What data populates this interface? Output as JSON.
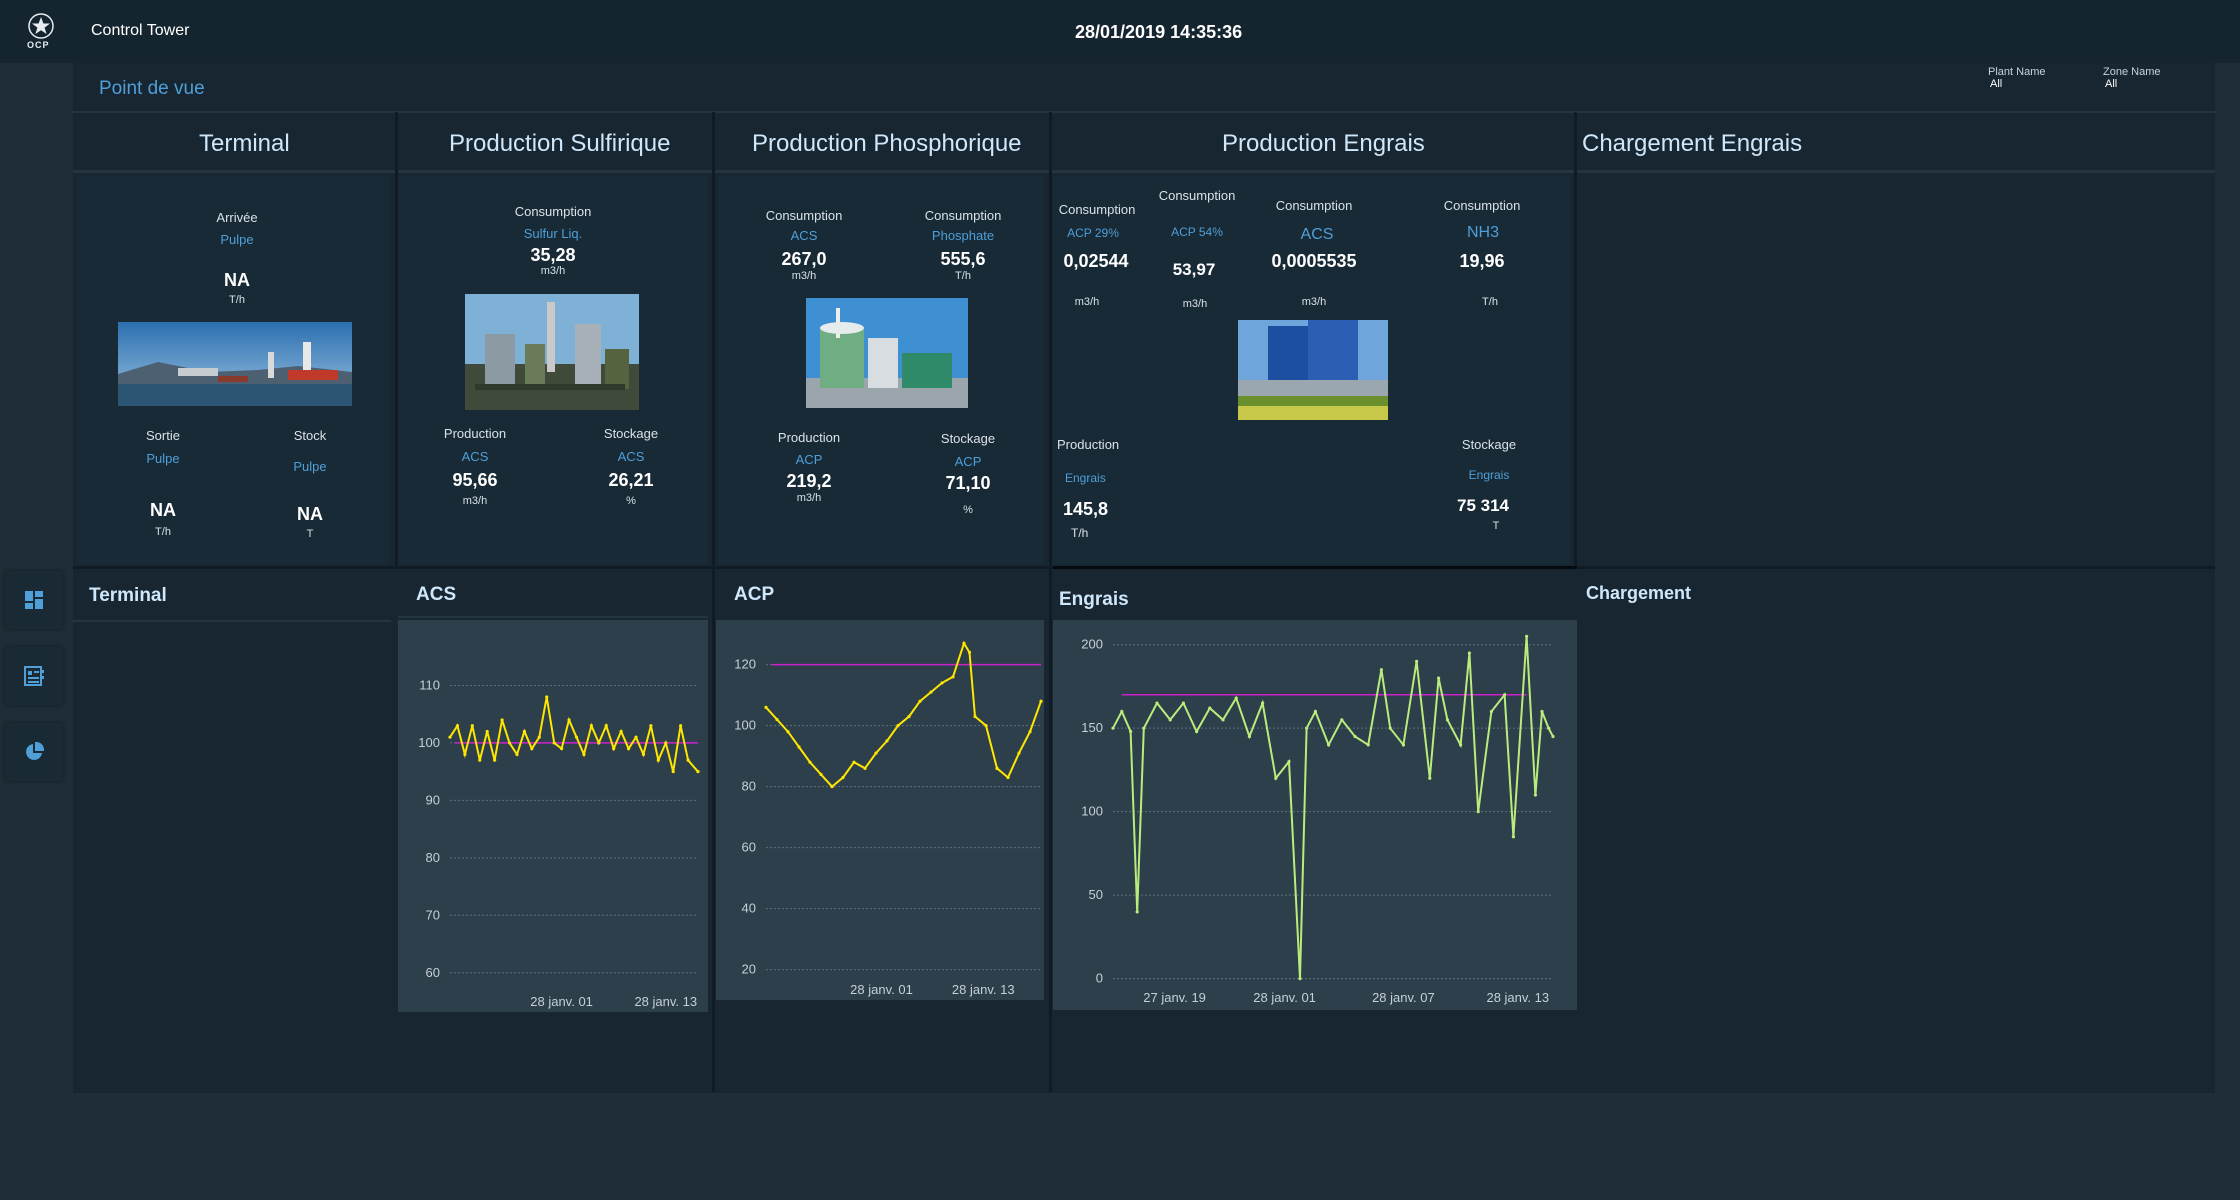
{
  "header": {
    "logo_text": "OCP",
    "app_title": "Control Tower",
    "datetime": "28/01/2019 14:35:36"
  },
  "toolbar": {
    "point_de_vue": "Point de vue",
    "plant_label": "Plant Name",
    "plant_value": "All",
    "zone_label": "Zone Name",
    "zone_value": "All"
  },
  "sections": {
    "terminal": "Terminal",
    "sulfurique": "Production Sulfirique",
    "phosphorique": "Production Phosphorique",
    "engrais": "Production Engrais",
    "chargement": "Chargement Engrais"
  },
  "terminal_card": {
    "arrivee": {
      "label": "Arrivée",
      "product": "Pulpe",
      "value": "NA",
      "unit": "T/h"
    },
    "sortie": {
      "label": "Sortie",
      "product": "Pulpe",
      "value": "NA",
      "unit": "T/h"
    },
    "stock": {
      "label": "Stock",
      "product": "Pulpe",
      "value": "NA",
      "unit": "T"
    }
  },
  "sulfurique_card": {
    "consumption": {
      "label": "Consumption",
      "product": "Sulfur Liq.",
      "value": "35,28",
      "unit": "m3/h"
    },
    "production": {
      "label": "Production",
      "product": "ACS",
      "value": "95,66",
      "unit": "m3/h"
    },
    "stockage": {
      "label": "Stockage",
      "product": "ACS",
      "value": "26,21",
      "unit": "%"
    }
  },
  "phosphorique_card": {
    "consumption1": {
      "label": "Consumption",
      "product": "ACS",
      "value": "267,0",
      "unit": "m3/h"
    },
    "consumption2": {
      "label": "Consumption",
      "product": "Phosphate",
      "value": "555,6",
      "unit": "T/h"
    },
    "production": {
      "label": "Production",
      "product": "ACP",
      "value": "219,2",
      "unit": "m3/h"
    },
    "stockage": {
      "label": "Stockage",
      "product": "ACP",
      "value": "71,10",
      "unit": "%"
    }
  },
  "engrais_card": {
    "consumption1": {
      "label": "Consumption",
      "product": "ACP 29%",
      "value": "0,02544",
      "unit": "m3/h"
    },
    "consumption2": {
      "label": "Consumption",
      "product": "ACP 54%",
      "value": "53,97",
      "unit": "m3/h"
    },
    "consumption3": {
      "label": "Consumption",
      "product": "ACS",
      "value": "0,0005535",
      "unit": "m3/h"
    },
    "consumption4": {
      "label": "Consumption",
      "product": "NH3",
      "value": "19,96",
      "unit": "T/h"
    },
    "production": {
      "label": "Production",
      "product": "Engrais",
      "value": "145,8",
      "unit": "T/h"
    },
    "stockage": {
      "label": "Stockage",
      "product": "Engrais",
      "value": "75 314",
      "unit": "T"
    }
  },
  "bottom_titles": {
    "terminal": "Terminal",
    "acs": "ACS",
    "acp": "ACP",
    "engrais": "Engrais",
    "chargement": "Chargement"
  },
  "nav": [
    "dashboard-icon",
    "report-icon",
    "pie-chart-icon"
  ],
  "colors": {
    "accent_blue": "#4f9fd8",
    "series_yellow": "#ffe600",
    "series_green": "#b9ec7c",
    "target_magenta": "#cc22cc"
  },
  "chart_data": [
    {
      "type": "line",
      "name": "acs",
      "title": "ACS",
      "ylim": [
        57,
        120
      ],
      "yticks": [
        110,
        100,
        90,
        80,
        70,
        60
      ],
      "xtick_labels": [
        "28 janv. 01",
        "28 janv. 13"
      ],
      "x": [
        0,
        0.03,
        0.06,
        0.09,
        0.12,
        0.15,
        0.18,
        0.21,
        0.24,
        0.27,
        0.3,
        0.33,
        0.36,
        0.39,
        0.42,
        0.45,
        0.48,
        0.51,
        0.54,
        0.57,
        0.6,
        0.63,
        0.66,
        0.69,
        0.72,
        0.75,
        0.78,
        0.81,
        0.84,
        0.87,
        0.9,
        0.93,
        0.96,
        1
      ],
      "values": [
        101,
        103,
        98,
        103,
        97,
        102,
        97,
        104,
        100,
        98,
        102,
        99,
        101,
        108,
        100,
        99,
        104,
        101,
        98,
        103,
        100,
        103,
        99,
        102,
        99,
        101,
        98,
        103,
        97,
        100,
        95,
        103,
        97,
        95
      ],
      "target": 100,
      "grid": true
    },
    {
      "type": "line",
      "name": "acp",
      "title": "ACP",
      "ylim": [
        14,
        132
      ],
      "yticks": [
        120,
        100,
        80,
        60,
        40,
        20
      ],
      "xtick_labels": [
        "28 janv. 01",
        "28 janv. 13"
      ],
      "x": [
        0,
        0.04,
        0.08,
        0.12,
        0.16,
        0.2,
        0.24,
        0.28,
        0.32,
        0.36,
        0.4,
        0.44,
        0.48,
        0.52,
        0.56,
        0.6,
        0.64,
        0.68,
        0.72,
        0.74,
        0.76,
        0.8,
        0.84,
        0.88,
        0.92,
        0.96,
        1
      ],
      "values": [
        106,
        102,
        98,
        93,
        88,
        84,
        80,
        83,
        88,
        86,
        91,
        95,
        100,
        103,
        108,
        111,
        114,
        116,
        127,
        124,
        103,
        100,
        86,
        83,
        91,
        98,
        108
      ],
      "target": 120,
      "grid": true
    },
    {
      "type": "line",
      "name": "engrais",
      "title": "Engrais",
      "ylim": [
        -8,
        210
      ],
      "yticks": [
        200,
        150,
        100,
        50,
        0
      ],
      "xtick_labels": [
        "27 janv. 19",
        "28 janv. 01",
        "28 janv. 07",
        "28 janv. 13"
      ],
      "x": [
        0,
        0.02,
        0.04,
        0.055,
        0.07,
        0.1,
        0.13,
        0.16,
        0.19,
        0.22,
        0.25,
        0.28,
        0.31,
        0.34,
        0.37,
        0.4,
        0.425,
        0.44,
        0.46,
        0.49,
        0.52,
        0.55,
        0.58,
        0.61,
        0.63,
        0.66,
        0.69,
        0.72,
        0.74,
        0.76,
        0.79,
        0.81,
        0.83,
        0.86,
        0.89,
        0.91,
        0.94,
        0.96,
        0.975,
        0.99,
        1
      ],
      "values": [
        150,
        160,
        148,
        40,
        150,
        165,
        155,
        165,
        148,
        162,
        155,
        168,
        145,
        165,
        120,
        130,
        0,
        150,
        160,
        140,
        155,
        145,
        140,
        185,
        150,
        140,
        190,
        120,
        180,
        155,
        140,
        195,
        100,
        160,
        170,
        85,
        205,
        110,
        160,
        150,
        145
      ],
      "target": 170,
      "grid": true
    }
  ]
}
